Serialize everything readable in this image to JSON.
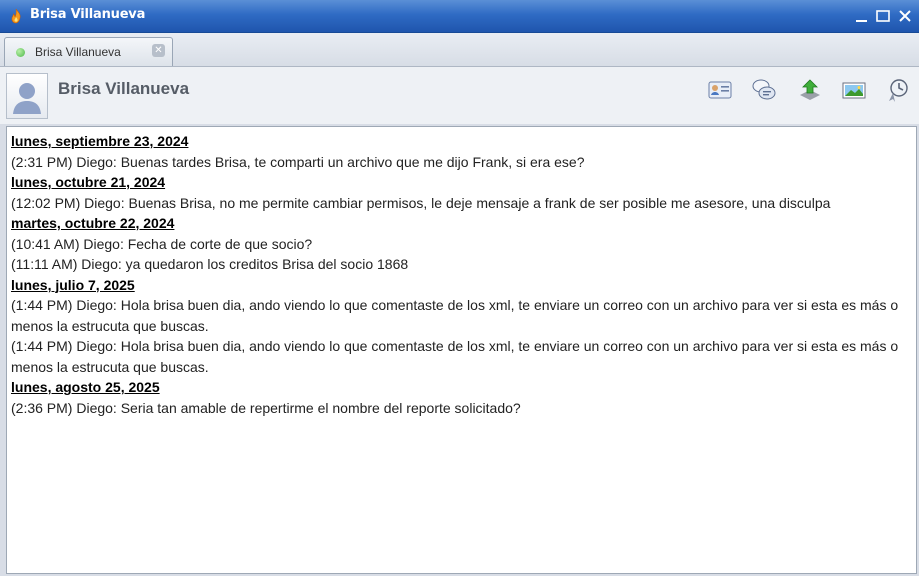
{
  "window": {
    "title": "Brisa Villanueva"
  },
  "tab": {
    "label": "Brisa Villanueva",
    "close_symbol": "✕"
  },
  "header": {
    "contact_name": "Brisa Villanueva",
    "toolbar_icons": [
      "contact-card-icon",
      "chat-bubbles-icon",
      "send-file-icon",
      "screenshot-icon",
      "history-clock-icon"
    ]
  },
  "conversation": [
    {
      "date": "lunes, septiembre 23, 2024 ",
      "messages": [
        "(2:31 PM) Diego: Buenas tardes Brisa, te comparti un archivo que me dijo Frank, si era ese?"
      ]
    },
    {
      "date": "lunes, octubre 21, 2024 ",
      "messages": [
        "(12:02 PM) Diego: Buenas Brisa, no me permite cambiar permisos, le deje mensaje a frank de ser posible me asesore, una disculpa"
      ]
    },
    {
      "date": "martes, octubre 22, 2024 ",
      "messages": [
        "(10:41 AM) Diego: Fecha de corte de que socio?",
        "(11:11 AM) Diego: ya quedaron los creditos Brisa del socio 1868"
      ]
    },
    {
      "date": "lunes, julio 7, 2025 ",
      "messages": [
        "(1:44 PM) Diego: Hola brisa buen dia, ando viendo lo que comentaste de los xml, te enviare un correo con un archivo  para ver si esta es más o menos la estrucuta que buscas.",
        "(1:44 PM) Diego: Hola brisa buen dia, ando viendo lo que comentaste de los xml, te enviare un correo con un archivo  para ver si esta es más o menos la estrucuta que buscas."
      ]
    },
    {
      "date": "lunes, agosto 25, 2025 ",
      "messages": [
        "(2:36 PM) Diego: Seria tan amable de repertirme el nombre del reporte solicitado?"
      ]
    }
  ]
}
